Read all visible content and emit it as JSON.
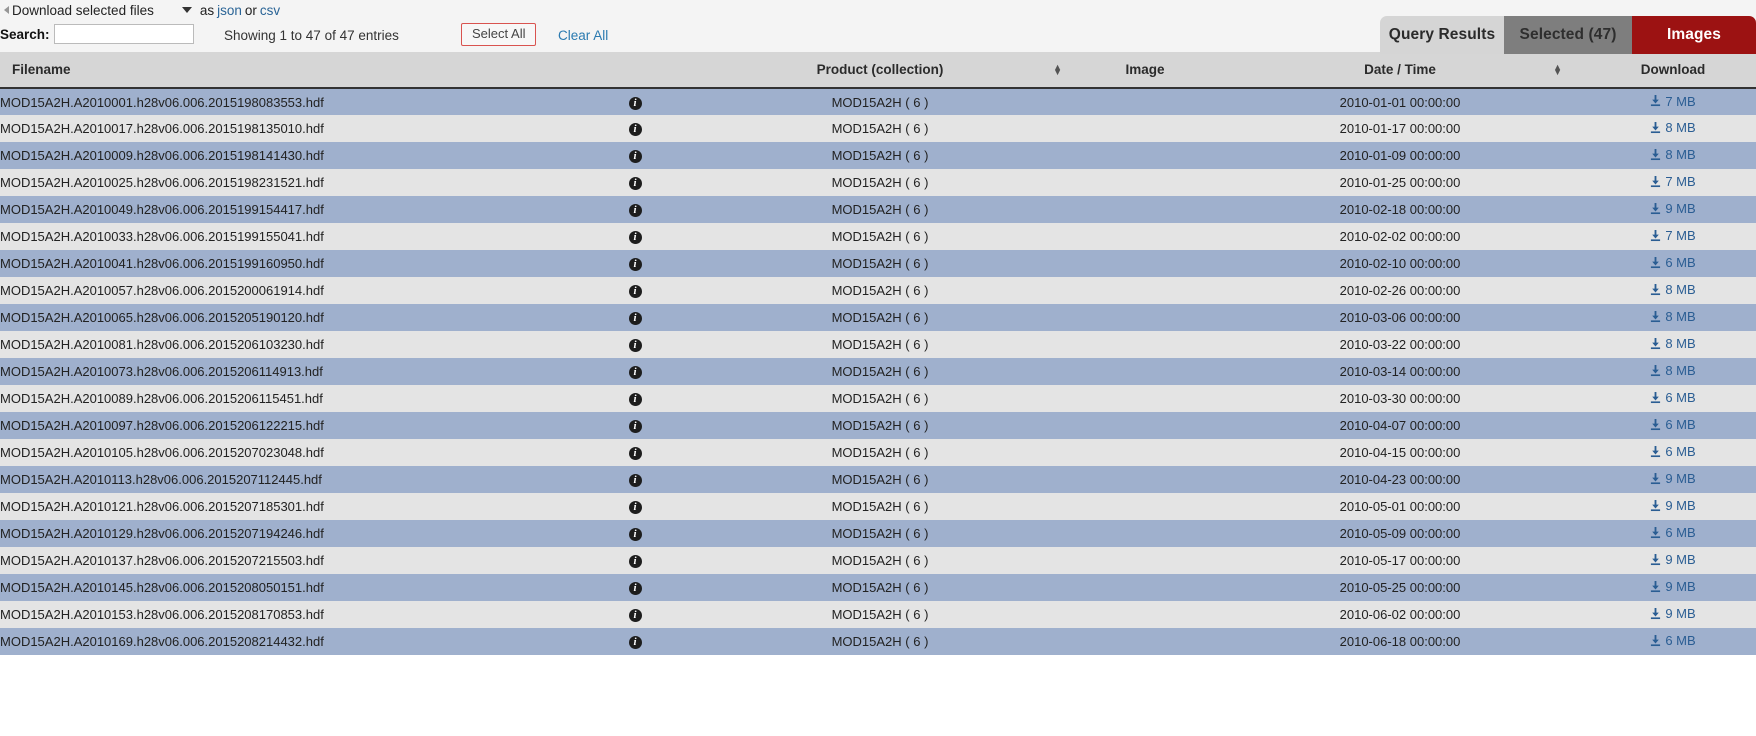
{
  "toolbar": {
    "download_label": "Download selected files",
    "as_label": "as",
    "json_link": "json",
    "or_label": "or",
    "csv_link": "csv",
    "search_label": "Search:",
    "search_value": "",
    "search_placeholder": "",
    "showing_info": "Showing 1 to 47 of 47 entries",
    "select_all_label": "Select All",
    "clear_all_label": "Clear All"
  },
  "tabs": [
    {
      "label": "Query Results",
      "state": "active"
    },
    {
      "label": "Selected (47)",
      "state": "inactive"
    },
    {
      "label": "Images",
      "state": "highlight"
    }
  ],
  "colors": {
    "tab_active_bg": "#d5d5d5",
    "tab_selected_bg": "#7e7e7e",
    "tab_images_bg": "#9c1212",
    "row_odd_bg": "#9fb0cd",
    "row_even_bg": "#e4e4e4",
    "header_bg": "#d6d6d6",
    "link_blue": "#2a6496",
    "select_all_border": "#d9534f"
  },
  "table": {
    "columns": [
      {
        "label": "Filename",
        "sortable": true
      },
      {
        "label": "",
        "sortable": false
      },
      {
        "label": "Product (collection)",
        "sortable": true
      },
      {
        "label": "Image",
        "sortable": false
      },
      {
        "label": "Date / Time",
        "sortable": true
      },
      {
        "label": "Download",
        "sortable": false
      }
    ],
    "rows": [
      {
        "filename": "MOD15A2H.A2010001.h28v06.006.2015198083553.hdf",
        "info": "info-icon",
        "product": "MOD15A2H ( 6 )",
        "image": "",
        "datetime": "2010-01-01 00:00:00",
        "download": "7 MB"
      },
      {
        "filename": "MOD15A2H.A2010017.h28v06.006.2015198135010.hdf",
        "info": "info-icon",
        "product": "MOD15A2H ( 6 )",
        "image": "",
        "datetime": "2010-01-17 00:00:00",
        "download": "8 MB"
      },
      {
        "filename": "MOD15A2H.A2010009.h28v06.006.2015198141430.hdf",
        "info": "info-icon",
        "product": "MOD15A2H ( 6 )",
        "image": "",
        "datetime": "2010-01-09 00:00:00",
        "download": "8 MB"
      },
      {
        "filename": "MOD15A2H.A2010025.h28v06.006.2015198231521.hdf",
        "info": "info-icon",
        "product": "MOD15A2H ( 6 )",
        "image": "",
        "datetime": "2010-01-25 00:00:00",
        "download": "7 MB"
      },
      {
        "filename": "MOD15A2H.A2010049.h28v06.006.2015199154417.hdf",
        "info": "info-icon",
        "product": "MOD15A2H ( 6 )",
        "image": "",
        "datetime": "2010-02-18 00:00:00",
        "download": "9 MB"
      },
      {
        "filename": "MOD15A2H.A2010033.h28v06.006.2015199155041.hdf",
        "info": "info-icon",
        "product": "MOD15A2H ( 6 )",
        "image": "",
        "datetime": "2010-02-02 00:00:00",
        "download": "7 MB"
      },
      {
        "filename": "MOD15A2H.A2010041.h28v06.006.2015199160950.hdf",
        "info": "info-icon",
        "product": "MOD15A2H ( 6 )",
        "image": "",
        "datetime": "2010-02-10 00:00:00",
        "download": "6 MB"
      },
      {
        "filename": "MOD15A2H.A2010057.h28v06.006.2015200061914.hdf",
        "info": "info-icon",
        "product": "MOD15A2H ( 6 )",
        "image": "",
        "datetime": "2010-02-26 00:00:00",
        "download": "8 MB"
      },
      {
        "filename": "MOD15A2H.A2010065.h28v06.006.2015205190120.hdf",
        "info": "info-icon",
        "product": "MOD15A2H ( 6 )",
        "image": "",
        "datetime": "2010-03-06 00:00:00",
        "download": "8 MB"
      },
      {
        "filename": "MOD15A2H.A2010081.h28v06.006.2015206103230.hdf",
        "info": "info-icon",
        "product": "MOD15A2H ( 6 )",
        "image": "",
        "datetime": "2010-03-22 00:00:00",
        "download": "8 MB"
      },
      {
        "filename": "MOD15A2H.A2010073.h28v06.006.2015206114913.hdf",
        "info": "info-icon",
        "product": "MOD15A2H ( 6 )",
        "image": "",
        "datetime": "2010-03-14 00:00:00",
        "download": "8 MB"
      },
      {
        "filename": "MOD15A2H.A2010089.h28v06.006.2015206115451.hdf",
        "info": "info-icon",
        "product": "MOD15A2H ( 6 )",
        "image": "",
        "datetime": "2010-03-30 00:00:00",
        "download": "6 MB"
      },
      {
        "filename": "MOD15A2H.A2010097.h28v06.006.2015206122215.hdf",
        "info": "info-icon",
        "product": "MOD15A2H ( 6 )",
        "image": "",
        "datetime": "2010-04-07 00:00:00",
        "download": "6 MB"
      },
      {
        "filename": "MOD15A2H.A2010105.h28v06.006.2015207023048.hdf",
        "info": "info-icon",
        "product": "MOD15A2H ( 6 )",
        "image": "",
        "datetime": "2010-04-15 00:00:00",
        "download": "6 MB"
      },
      {
        "filename": "MOD15A2H.A2010113.h28v06.006.2015207112445.hdf",
        "info": "info-icon",
        "product": "MOD15A2H ( 6 )",
        "image": "",
        "datetime": "2010-04-23 00:00:00",
        "download": "9 MB"
      },
      {
        "filename": "MOD15A2H.A2010121.h28v06.006.2015207185301.hdf",
        "info": "info-icon",
        "product": "MOD15A2H ( 6 )",
        "image": "",
        "datetime": "2010-05-01 00:00:00",
        "download": "9 MB"
      },
      {
        "filename": "MOD15A2H.A2010129.h28v06.006.2015207194246.hdf",
        "info": "info-icon",
        "product": "MOD15A2H ( 6 )",
        "image": "",
        "datetime": "2010-05-09 00:00:00",
        "download": "6 MB"
      },
      {
        "filename": "MOD15A2H.A2010137.h28v06.006.2015207215503.hdf",
        "info": "info-icon",
        "product": "MOD15A2H ( 6 )",
        "image": "",
        "datetime": "2010-05-17 00:00:00",
        "download": "9 MB"
      },
      {
        "filename": "MOD15A2H.A2010145.h28v06.006.2015208050151.hdf",
        "info": "info-icon",
        "product": "MOD15A2H ( 6 )",
        "image": "",
        "datetime": "2010-05-25 00:00:00",
        "download": "9 MB"
      },
      {
        "filename": "MOD15A2H.A2010153.h28v06.006.2015208170853.hdf",
        "info": "info-icon",
        "product": "MOD15A2H ( 6 )",
        "image": "",
        "datetime": "2010-06-02 00:00:00",
        "download": "9 MB"
      },
      {
        "filename": "MOD15A2H.A2010169.h28v06.006.2015208214432.hdf",
        "info": "info-icon",
        "product": "MOD15A2H ( 6 )",
        "image": "",
        "datetime": "2010-06-18 00:00:00",
        "download": "6 MB"
      }
    ]
  }
}
